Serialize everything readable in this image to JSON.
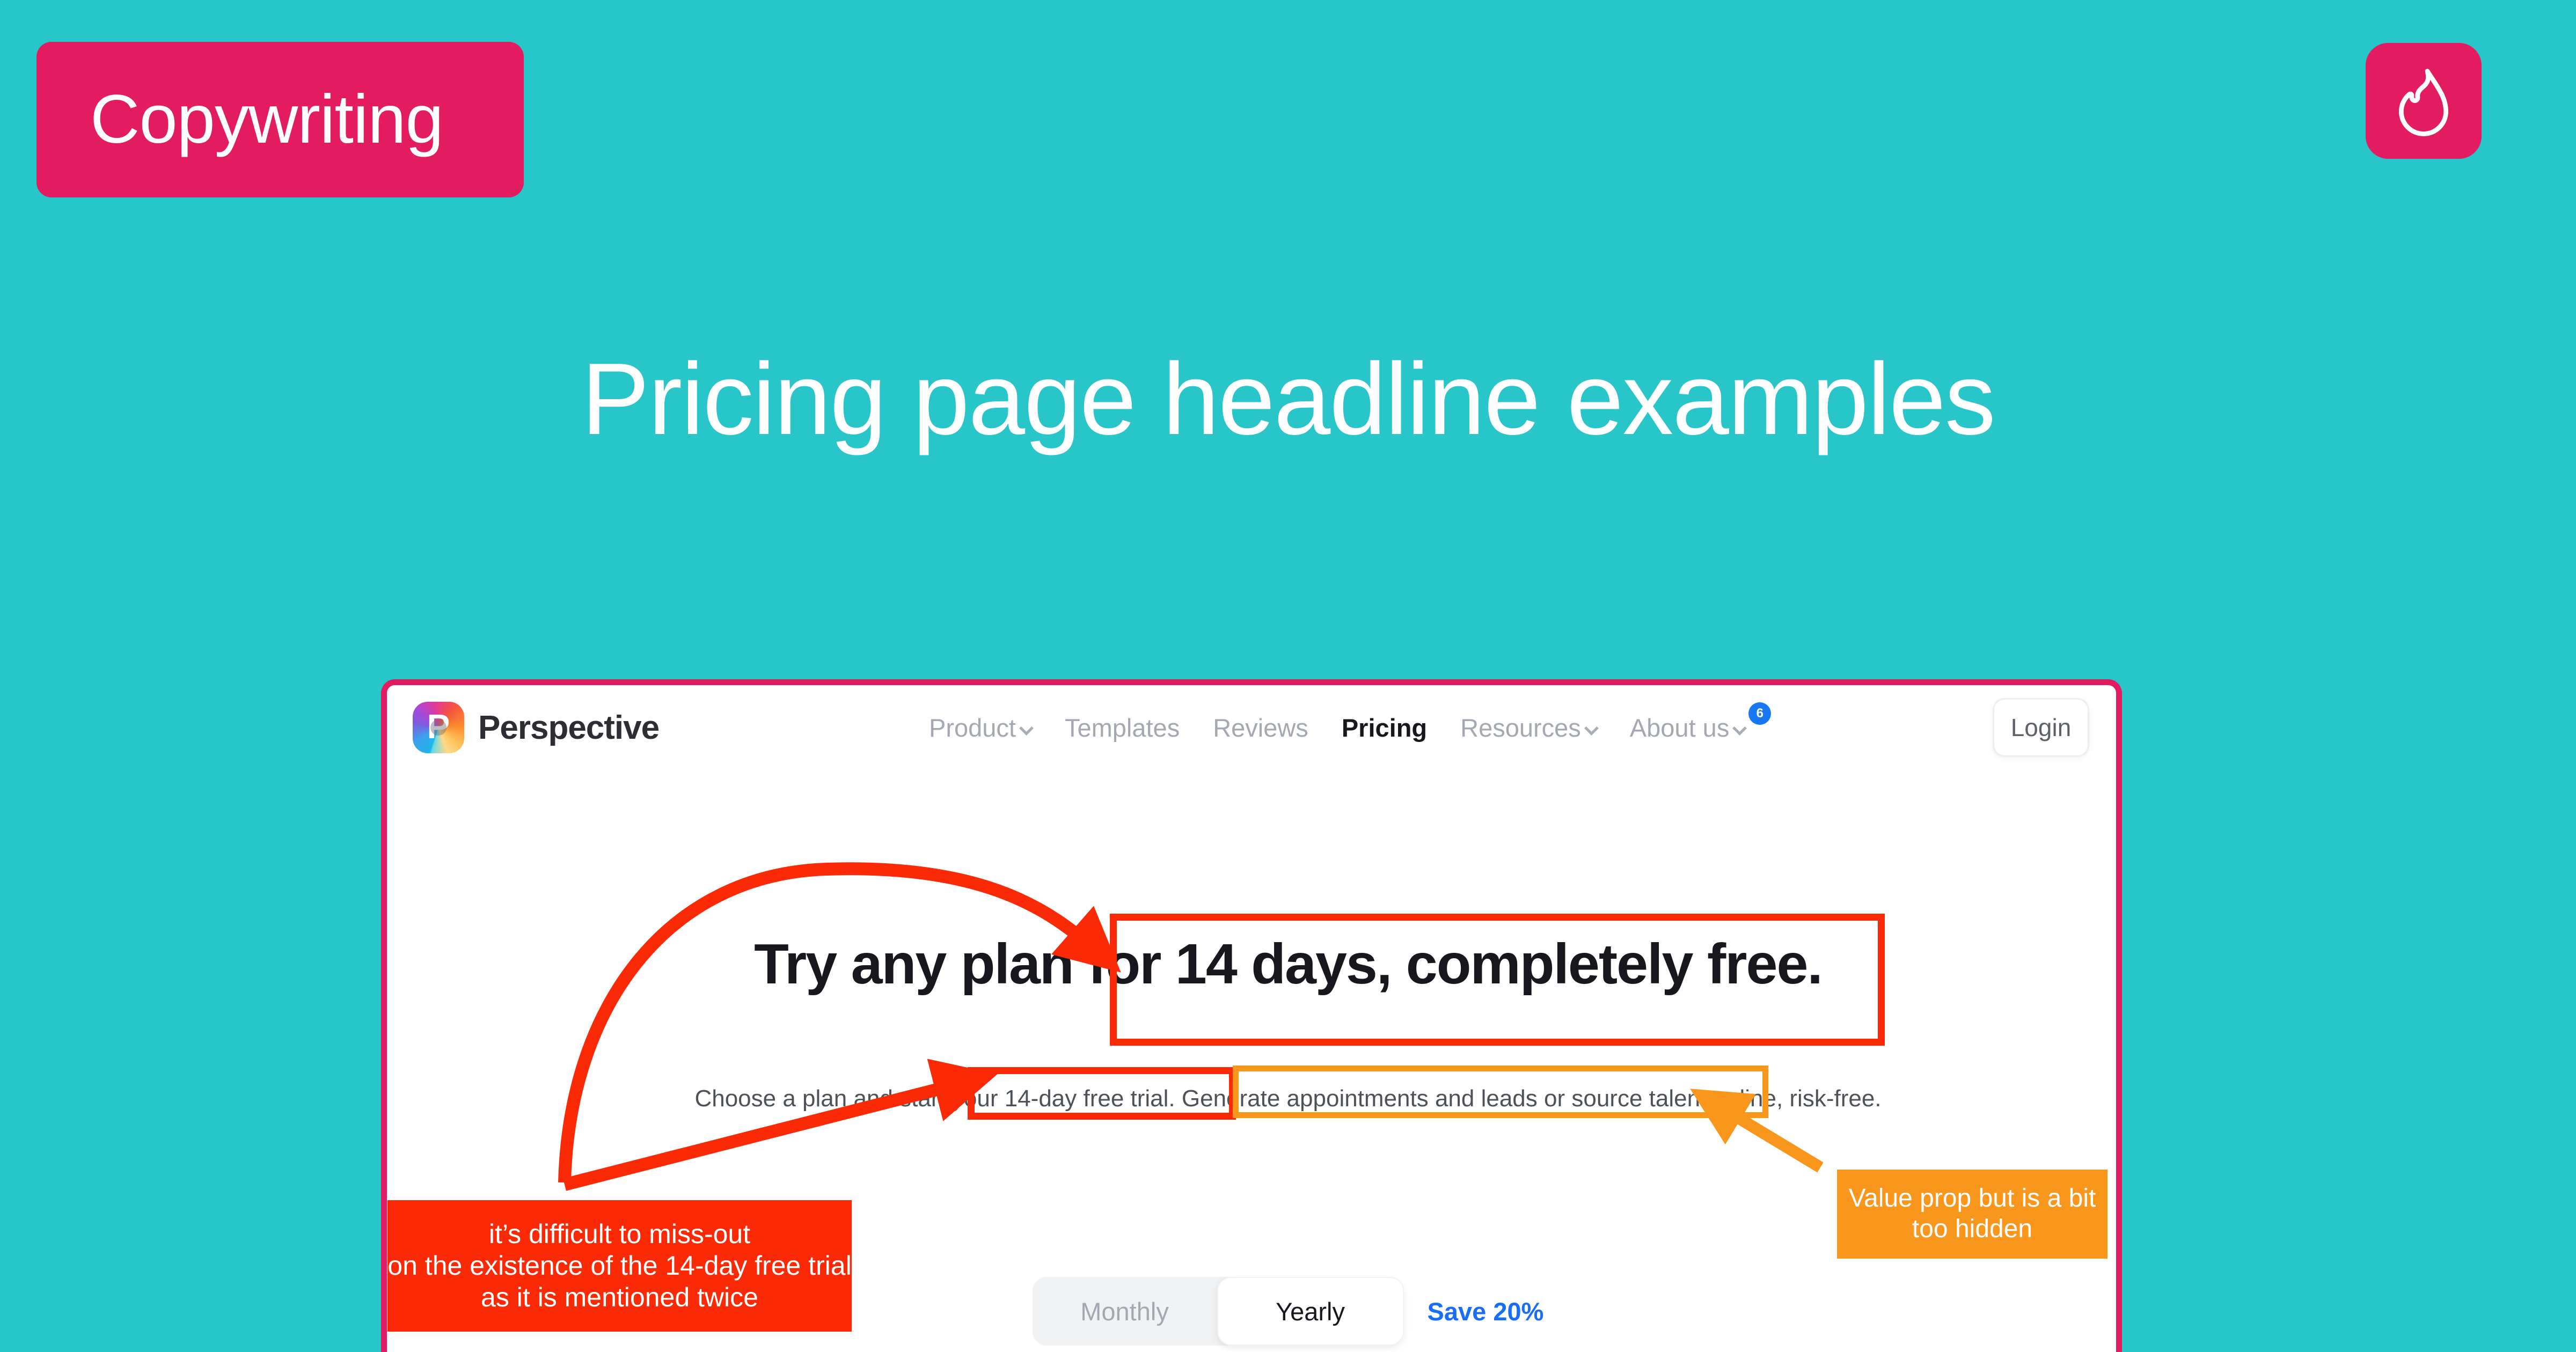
{
  "page": {
    "background_color": "#29c6c9",
    "accent_pink": "#e31b60",
    "annotation_red": "#fa2a06",
    "annotation_orange": "#f9971d"
  },
  "category_badge": {
    "label": "Copywriting"
  },
  "brand_mark": {
    "icon": "flame-icon"
  },
  "hero": {
    "title": "Pricing page headline examples"
  },
  "site": {
    "nav": {
      "brand_name": "Perspective",
      "logo_letter": "P",
      "links": [
        {
          "label": "Product",
          "has_chevron": true,
          "active": false
        },
        {
          "label": "Templates",
          "has_chevron": false,
          "active": false
        },
        {
          "label": "Reviews",
          "has_chevron": false,
          "active": false
        },
        {
          "label": "Pricing",
          "has_chevron": false,
          "active": true
        },
        {
          "label": "Resources",
          "has_chevron": true,
          "active": false
        },
        {
          "label": "About us",
          "has_chevron": true,
          "active": false
        }
      ],
      "badge_count": "6",
      "badge_color": "#1877f2",
      "login_label": "Login"
    },
    "pricing": {
      "headline_plain": "Try any plan ",
      "headline_boxed": "for 14 days, completely free.",
      "sub_part1": "Choose a plan and ",
      "sub_part2_boxed_red": "start your 14-day free trial.",
      "sub_part3_boxed_orange": " Generate appointments and leads or source talent online",
      "sub_part4": ", risk-free.",
      "billing": {
        "monthly_label": "Monthly",
        "yearly_label": "Yearly",
        "selected": "Yearly",
        "save_label": "Save 20%"
      }
    }
  },
  "annotations": {
    "red_note": {
      "line1": "it’s difficult to miss-out",
      "line2": "on the existence of the 14-day free trial",
      "line3": "as it is mentioned twice"
    },
    "orange_note": {
      "line1": "Value prop but is a bit",
      "line2": "too hidden"
    }
  }
}
